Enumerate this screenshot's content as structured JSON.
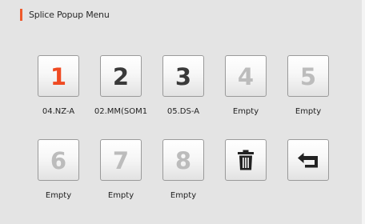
{
  "title": "Splice Popup Menu",
  "colors": {
    "accent": "#ee5a2c",
    "selected_number": "#ef4a22",
    "used_number": "#3a3a3a",
    "empty_number": "#bcbcbc"
  },
  "slots": [
    {
      "number": "1",
      "label": "04.NZ-A",
      "state": "selected"
    },
    {
      "number": "2",
      "label": "02.MM(SOM1",
      "state": "used"
    },
    {
      "number": "3",
      "label": "05.DS-A",
      "state": "used"
    },
    {
      "number": "4",
      "label": "Empty",
      "state": "empty"
    },
    {
      "number": "5",
      "label": "Empty",
      "state": "empty"
    },
    {
      "number": "6",
      "label": "Empty",
      "state": "empty"
    },
    {
      "number": "7",
      "label": "Empty",
      "state": "empty"
    },
    {
      "number": "8",
      "label": "Empty",
      "state": "empty"
    }
  ],
  "actions": {
    "delete_icon": "trash-icon",
    "back_icon": "return-arrow-icon"
  }
}
